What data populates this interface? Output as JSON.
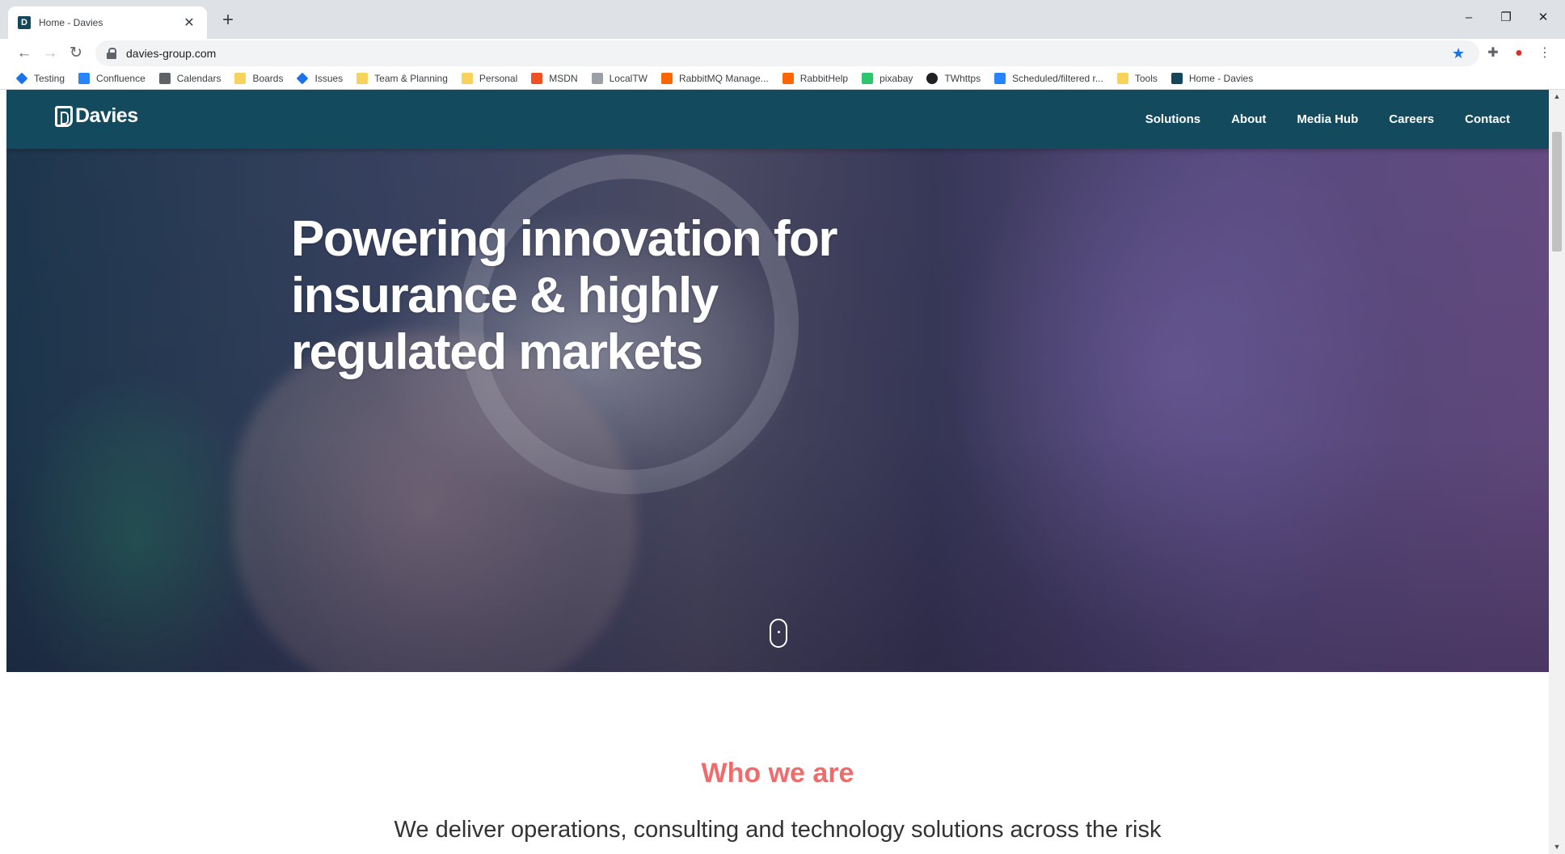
{
  "browser": {
    "tab_title": "Home - Davies",
    "tab_favicon": "D",
    "new_tab_label": "+",
    "url": "davies-group.com",
    "window_controls": {
      "minimize": "–",
      "restore": "❐",
      "close": "✕"
    }
  },
  "bookmarks": [
    {
      "label": "Testing",
      "icon": "diamond-icon",
      "color": "#1a73e8"
    },
    {
      "label": "Confluence",
      "icon": "confluence-icon",
      "color": "#2684ff"
    },
    {
      "label": "Calendars",
      "icon": "calendar-icon",
      "color": "#5f6368"
    },
    {
      "label": "Boards",
      "icon": "folder-icon",
      "color": "#f7d35c"
    },
    {
      "label": "Issues",
      "icon": "diamond-icon",
      "color": "#1a73e8"
    },
    {
      "label": "Team & Planning",
      "icon": "folder-icon",
      "color": "#f7d35c"
    },
    {
      "label": "Personal",
      "icon": "folder-icon",
      "color": "#f7d35c"
    },
    {
      "label": "MSDN",
      "icon": "microsoft-icon",
      "color": "#f25022"
    },
    {
      "label": "LocalTW",
      "icon": "page-icon",
      "color": "#9aa0a6"
    },
    {
      "label": "RabbitMQ Manage...",
      "icon": "rabbitmq-icon",
      "color": "#ff6600"
    },
    {
      "label": "RabbitHelp",
      "icon": "rabbitmq-icon",
      "color": "#ff6600"
    },
    {
      "label": "pixabay",
      "icon": "pixabay-icon",
      "color": "#2ec66d"
    },
    {
      "label": "TWhttps",
      "icon": "circle-1-icon",
      "color": "#202124"
    },
    {
      "label": "Scheduled/filtered r...",
      "icon": "confluence-icon",
      "color": "#2684ff"
    },
    {
      "label": "Tools",
      "icon": "folder-icon",
      "color": "#f7d35c"
    },
    {
      "label": "Home - Davies",
      "icon": "davies-favicon-icon",
      "color": "#14475a"
    }
  ],
  "site": {
    "logo_text": "Davies",
    "nav": [
      "Solutions",
      "About",
      "Media Hub",
      "Careers",
      "Contact"
    ],
    "hero_headline": "Powering innovation for insurance & highly regulated markets",
    "section_heading": "Who we are",
    "intro_text": "We deliver operations, consulting and technology solutions across the risk"
  },
  "colors": {
    "nav_background": "#144a5e",
    "accent_heading": "#f06b6b",
    "star_blue": "#1a73e8"
  }
}
